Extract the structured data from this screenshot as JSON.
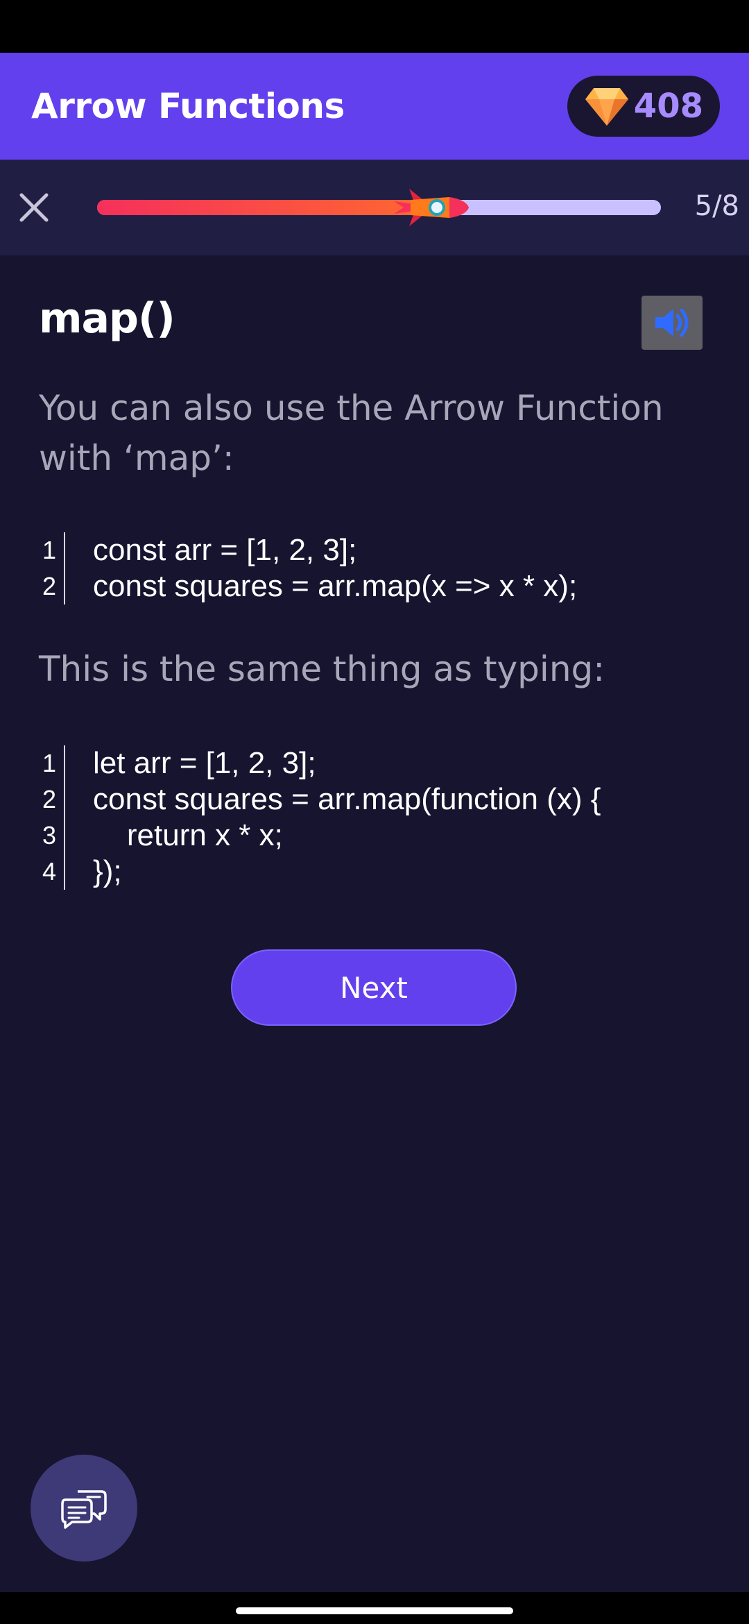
{
  "header": {
    "title": "Arrow Functions",
    "gems": "408",
    "gem_icon": "diamond-gem-icon"
  },
  "progress": {
    "current": 5,
    "total": 8,
    "label": "5/8",
    "fraction": 0.625,
    "close_icon": "close-icon",
    "marker_icon": "rocket-icon"
  },
  "lesson": {
    "title": "map()",
    "audio_icon": "speaker-icon",
    "intro": "You can also use the Arrow Function with ‘map’:",
    "code1": [
      {
        "n": "1",
        "text": "const arr = [1, 2, 3];"
      },
      {
        "n": "2",
        "text": "const squares = arr.map(x => x * x);"
      }
    ],
    "middle": "This is the same thing as typing:",
    "code2": [
      {
        "n": "1",
        "text": "let arr = [1, 2, 3];"
      },
      {
        "n": "2",
        "text": "const squares = arr.map(function (x) {"
      },
      {
        "n": "3",
        "text": "    return x * x;"
      },
      {
        "n": "4",
        "text": "});"
      }
    ],
    "next_label": "Next"
  },
  "fab": {
    "icon": "chat-bubbles-icon"
  },
  "colors": {
    "brand": "#6240EE",
    "background": "#17142F",
    "progress_start": "#F5305B",
    "progress_end": "#FF6B2E",
    "progress_track": "#C9C0FF",
    "gem_count": "#A68BFF"
  }
}
